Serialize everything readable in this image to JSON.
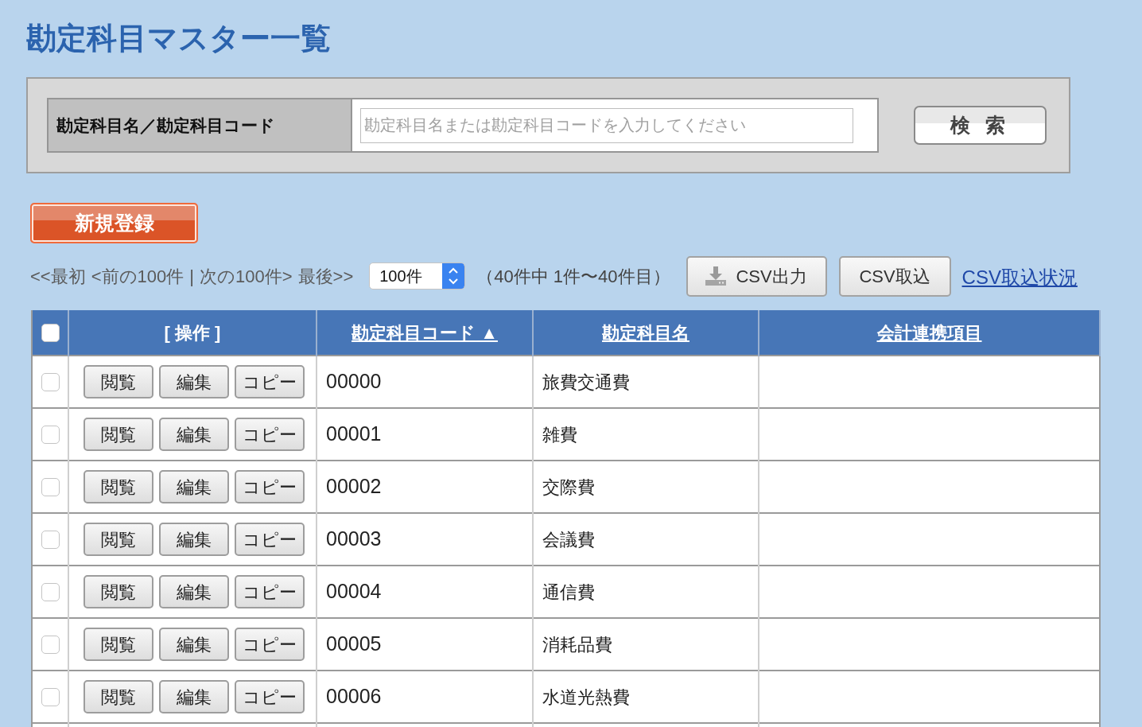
{
  "page": {
    "title": "勘定科目マスター一覧"
  },
  "search": {
    "label": "勘定科目名／勘定科目コード",
    "placeholder": "勘定科目名または勘定科目コードを入力してください",
    "button": "検 索"
  },
  "new_button": "新規登録",
  "toolbar": {
    "pagination": [
      {
        "kind": "link",
        "label": "<<最初",
        "disabled": true
      },
      {
        "kind": "link",
        "label": "<前の100件",
        "disabled": true
      },
      {
        "kind": "separator",
        "label": "|"
      },
      {
        "kind": "link",
        "label": "次の100件>",
        "disabled": true
      },
      {
        "kind": "link",
        "label": "最後>>",
        "disabled": true
      }
    ],
    "per_page": {
      "value": "100件"
    },
    "summary": "（40件中 1件〜40件目）",
    "csv_buttons": [
      {
        "kind": "export",
        "label": "CSV出力"
      },
      {
        "kind": "import",
        "label": "CSV取込"
      }
    ],
    "csv_status_link": "CSV取込状況"
  },
  "table": {
    "select_all": {
      "checked": false
    },
    "columns": [
      {
        "kind": "plain",
        "label": "[ 操作 ]"
      },
      {
        "kind": "sort_link",
        "label": "勘定科目コード",
        "sort_mark": "▲"
      },
      {
        "kind": "sort_link",
        "label": "勘定科目名"
      },
      {
        "kind": "sort_link",
        "label": "会計連携項目"
      }
    ],
    "rows": [
      {
        "checked": false,
        "actions": [
          "閲覧",
          "編集",
          "コピー"
        ],
        "code": "00000",
        "name": "旅費交通費"
      },
      {
        "checked": false,
        "actions": [
          "閲覧",
          "編集",
          "コピー"
        ],
        "code": "00001",
        "name": "雑費"
      },
      {
        "checked": false,
        "actions": [
          "閲覧",
          "編集",
          "コピー"
        ],
        "code": "00002",
        "name": "交際費"
      },
      {
        "checked": false,
        "actions": [
          "閲覧",
          "編集",
          "コピー"
        ],
        "code": "00003",
        "name": "会議費"
      },
      {
        "checked": false,
        "actions": [
          "閲覧",
          "編集",
          "コピー"
        ],
        "code": "00004",
        "name": "通信費"
      },
      {
        "checked": false,
        "actions": [
          "閲覧",
          "編集",
          "コピー"
        ],
        "code": "00005",
        "name": "消耗品費"
      },
      {
        "checked": false,
        "actions": [
          "閲覧",
          "編集",
          "コピー"
        ],
        "code": "00006",
        "name": "水道光熱費"
      }
    ]
  }
}
